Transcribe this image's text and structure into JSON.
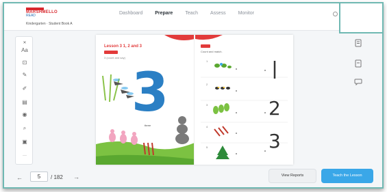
{
  "header": {
    "logo_line1": "MARSHMELLO",
    "logo_line2": "READ",
    "subtitle": "Kindergarten · Student Book A",
    "nav": [
      {
        "label": "Dashboard",
        "active": false
      },
      {
        "label": "Prepare",
        "active": true
      },
      {
        "label": "Teach",
        "active": false
      },
      {
        "label": "Assess",
        "active": false
      },
      {
        "label": "Monitor",
        "active": false
      }
    ]
  },
  "toolbar": {
    "tools": [
      {
        "icon": "collapse-icon",
        "glyph": "✕"
      },
      {
        "icon": "text-icon",
        "glyph": "Aa"
      },
      {
        "icon": "image-icon",
        "glyph": "⊡"
      },
      {
        "icon": "pen-icon",
        "glyph": "✎"
      },
      {
        "icon": "highlighter-icon",
        "glyph": "✐"
      },
      {
        "icon": "table-icon",
        "glyph": "▤"
      },
      {
        "icon": "eye-icon",
        "glyph": "◉"
      },
      {
        "icon": "zoom-icon",
        "glyph": "⌕"
      },
      {
        "icon": "screen-icon",
        "glyph": "▣"
      },
      {
        "icon": "more-icon",
        "glyph": "···"
      }
    ]
  },
  "book": {
    "left": {
      "lesson_title": "Lesson 3    1, 2 and 3",
      "lesson_sub": "3 (count and say)",
      "big_number": "3",
      "word": "three"
    },
    "right": {
      "sub": "Count and match.",
      "rows": [
        {
          "label": "1",
          "number": "1"
        },
        {
          "label": "2",
          "number": ""
        },
        {
          "label": "3",
          "number": "2"
        },
        {
          "label": "4",
          "number": ""
        },
        {
          "label": "5",
          "number": "3"
        }
      ]
    }
  },
  "right_icons": [
    "document-icon",
    "bookmark-icon",
    "comment-icon"
  ],
  "pagination": {
    "current": "5",
    "total": "/ 182"
  },
  "buttons": {
    "reports": "View Reports",
    "teach": "Teach the Lesson"
  },
  "colors": {
    "accent": "#3aa7e8",
    "brand_red": "#d8282e",
    "number_blue": "#2b7fc4",
    "frame": "#6fb8b2"
  }
}
